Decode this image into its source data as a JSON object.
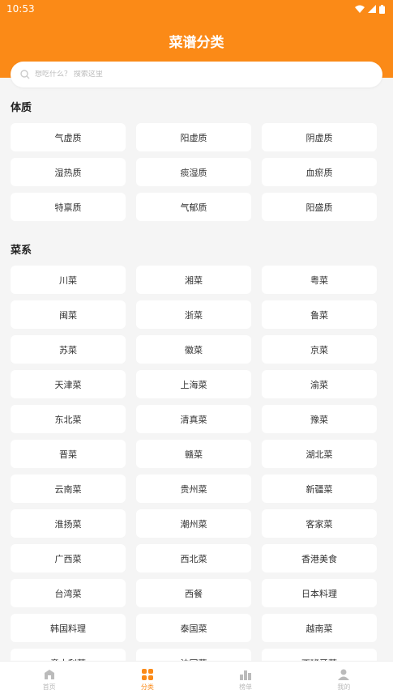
{
  "status": {
    "time": "10:53"
  },
  "header": {
    "title": "菜谱分类"
  },
  "search": {
    "placeholder": "想吃什么？ 搜索这里"
  },
  "sections": [
    {
      "title": "体质",
      "items": [
        "气虚质",
        "阳虚质",
        "阴虚质",
        "湿热质",
        "痰湿质",
        "血瘀质",
        "特禀质",
        "气郁质",
        "阳盛质"
      ]
    },
    {
      "title": "菜系",
      "items": [
        "川菜",
        "湘菜",
        "粤菜",
        "闽菜",
        "浙菜",
        "鲁菜",
        "苏菜",
        "徽菜",
        "京菜",
        "天津菜",
        "上海菜",
        "渝菜",
        "东北菜",
        "清真菜",
        "豫菜",
        "晋菜",
        "赣菜",
        "湖北菜",
        "云南菜",
        "贵州菜",
        "新疆菜",
        "淮扬菜",
        "潮州菜",
        "客家菜",
        "广西菜",
        "西北菜",
        "香港美食",
        "台湾菜",
        "西餐",
        "日本料理",
        "韩国料理",
        "泰国菜",
        "越南菜",
        "意大利菜",
        "法国菜",
        "西班牙菜"
      ]
    }
  ],
  "tabbar": [
    {
      "label": "首页",
      "icon": "home-icon",
      "active": false
    },
    {
      "label": "分类",
      "icon": "grid-icon",
      "active": true
    },
    {
      "label": "榜单",
      "icon": "chart-icon",
      "active": false
    },
    {
      "label": "我的",
      "icon": "user-icon",
      "active": false
    }
  ],
  "colors": {
    "accent": "#fb8a17",
    "background": "#f5f5f5"
  }
}
